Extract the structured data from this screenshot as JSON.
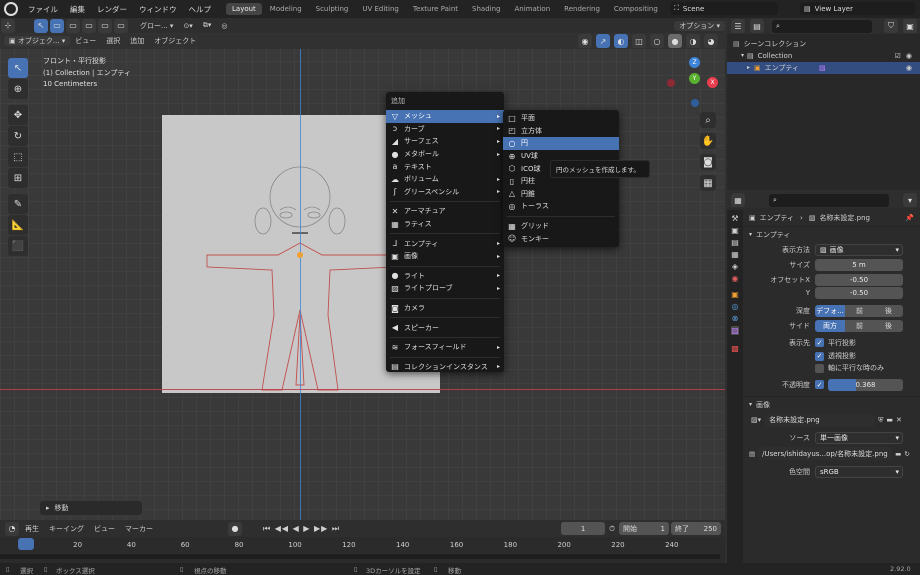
{
  "topbar": {
    "menus": [
      "ファイル",
      "編集",
      "レンダー",
      "ウィンドウ",
      "ヘルプ"
    ],
    "workspaces": [
      "Layout",
      "Modeling",
      "Sculpting",
      "UV Editing",
      "Texture Paint",
      "Shading",
      "Animation",
      "Rendering",
      "Compositing",
      "Scripting"
    ],
    "scene": "Scene",
    "view_layer": "View Layer"
  },
  "viewport_header": {
    "mode": "オブジェク...",
    "menus": [
      "ビュー",
      "選択",
      "追加",
      "オブジェクト"
    ],
    "orientation": "グロー...",
    "options": "オプション"
  },
  "viewport_overlay": {
    "view_name": "フロント・平行投影",
    "collection": "(1) Collection | エンプティ",
    "scale": "10 Centimeters"
  },
  "gizmo": {
    "z": "Z",
    "x": "X",
    "y": "Y"
  },
  "add_menu": {
    "title": "追加",
    "items": [
      {
        "label": "メッシュ",
        "icon": "mesh-icon",
        "glyph": "▽",
        "submenu": true
      },
      {
        "label": "カーブ",
        "icon": "curve-icon",
        "glyph": "ↄ",
        "submenu": true
      },
      {
        "label": "サーフェス",
        "icon": "surface-icon",
        "glyph": "◢",
        "submenu": true
      },
      {
        "label": "メタボール",
        "icon": "metaball-icon",
        "glyph": "●",
        "submenu": true
      },
      {
        "label": "テキスト",
        "icon": "text-icon",
        "glyph": "a",
        "submenu": false
      },
      {
        "label": "ボリューム",
        "icon": "volume-icon",
        "glyph": "☁",
        "submenu": true
      },
      {
        "label": "グリースペンシル",
        "icon": "grease-pencil-icon",
        "glyph": "ʃ",
        "submenu": true
      },
      {
        "label": "アーマチュア",
        "icon": "armature-icon",
        "glyph": "✕",
        "submenu": false
      },
      {
        "label": "ラティス",
        "icon": "lattice-icon",
        "glyph": "▦",
        "submenu": false
      },
      {
        "label": "エンプティ",
        "icon": "empty-icon",
        "glyph": "⅃",
        "submenu": true
      },
      {
        "label": "画像",
        "icon": "image-icon",
        "glyph": "▣",
        "submenu": true
      },
      {
        "label": "ライト",
        "icon": "light-icon",
        "glyph": "●",
        "submenu": true
      },
      {
        "label": "ライトプローブ",
        "icon": "light-probe-icon",
        "glyph": "▨",
        "submenu": true
      },
      {
        "label": "カメラ",
        "icon": "camera-icon",
        "glyph": "◙",
        "submenu": false
      },
      {
        "label": "スピーカー",
        "icon": "speaker-icon",
        "glyph": "◀",
        "submenu": false
      },
      {
        "label": "フォースフィールド",
        "icon": "force-field-icon",
        "glyph": "≋",
        "submenu": true
      },
      {
        "label": "コレクションインスタンス",
        "icon": "collection-instance-icon",
        "glyph": "▤",
        "submenu": true
      }
    ]
  },
  "mesh_menu": {
    "items": [
      {
        "label": "平面",
        "icon": "plane-icon",
        "glyph": "□"
      },
      {
        "label": "立方体",
        "icon": "cube-icon",
        "glyph": "◰"
      },
      {
        "label": "円",
        "icon": "circle-icon",
        "glyph": "○"
      },
      {
        "label": "UV球",
        "icon": "uv-sphere-icon",
        "glyph": "⊕"
      },
      {
        "label": "ICO球",
        "icon": "ico-sphere-icon",
        "glyph": "⬡"
      },
      {
        "label": "円柱",
        "icon": "cylinder-icon",
        "glyph": "▯"
      },
      {
        "label": "円錐",
        "icon": "cone-icon",
        "glyph": "△"
      },
      {
        "label": "トーラス",
        "icon": "torus-icon",
        "glyph": "◎"
      },
      {
        "label": "グリッド",
        "icon": "grid-icon",
        "glyph": "▦"
      },
      {
        "label": "モンキー",
        "icon": "monkey-icon",
        "glyph": "☺"
      }
    ],
    "tooltip": "円のメッシュを作成します。"
  },
  "last_operator": "移動",
  "outliner": {
    "root": "シーンコレクション",
    "collection": "Collection",
    "object": "エンプティ"
  },
  "properties": {
    "object_name": "エンプティ",
    "data_name": "名称未設定.png",
    "section": "エンプティ",
    "display_as_label": "表示方法",
    "display_as_value": "画像",
    "size_label": "サイズ",
    "size_value": "5 m",
    "offset_x_label": "オフセットX",
    "offset_x_value": "-0.50",
    "offset_y_label": "Y",
    "offset_y_value": "-0.50",
    "depth_label": "深度",
    "depth_options": [
      "デフォ...",
      "前",
      "後"
    ],
    "side_label": "サイド",
    "side_options": [
      "両方",
      "前",
      "後"
    ],
    "show_label": "表示先",
    "show_options": [
      {
        "label": "平行投影",
        "checked": true
      },
      {
        "label": "透視投影",
        "checked": true
      },
      {
        "label": "軸に平行な時のみ",
        "checked": false
      }
    ],
    "opacity_label": "不透明度",
    "opacity_value": "0.368",
    "opacity_fraction": 0.368,
    "image_section": "画像",
    "image_name": "名称未設定.png",
    "source_label": "ソース",
    "source_value": "単一画像",
    "filepath": "/Users/ishidayus...op/名称未設定.png",
    "colorspace_label": "色空間",
    "colorspace_value": "sRGB"
  },
  "timeline": {
    "menus": [
      "再生",
      "キーイング",
      "ビュー",
      "マーカー"
    ],
    "current_frame": "1",
    "start_label": "開始",
    "start": "1",
    "end_label": "終了",
    "end": "250",
    "ruler": [
      "1",
      "20",
      "40",
      "60",
      "80",
      "100",
      "120",
      "140",
      "160",
      "180",
      "200",
      "220",
      "240"
    ],
    "ruler_fracs": [
      0.0,
      0.0763,
      0.1566,
      0.2369,
      0.3173,
      0.3976,
      0.4779,
      0.5582,
      0.6386,
      0.7189,
      0.7992,
      0.8795,
      0.9598
    ]
  },
  "statusbar": {
    "items": [
      "選択",
      "ボックス選択",
      "視点の移動",
      "3Dカーソルを設定",
      "移動"
    ],
    "version": "2.92.0"
  },
  "colors": {
    "accent": "#4772b3",
    "axis_x": "#e83c4f",
    "axis_y": "#5bb12f",
    "axis_z": "#3d84d8"
  }
}
